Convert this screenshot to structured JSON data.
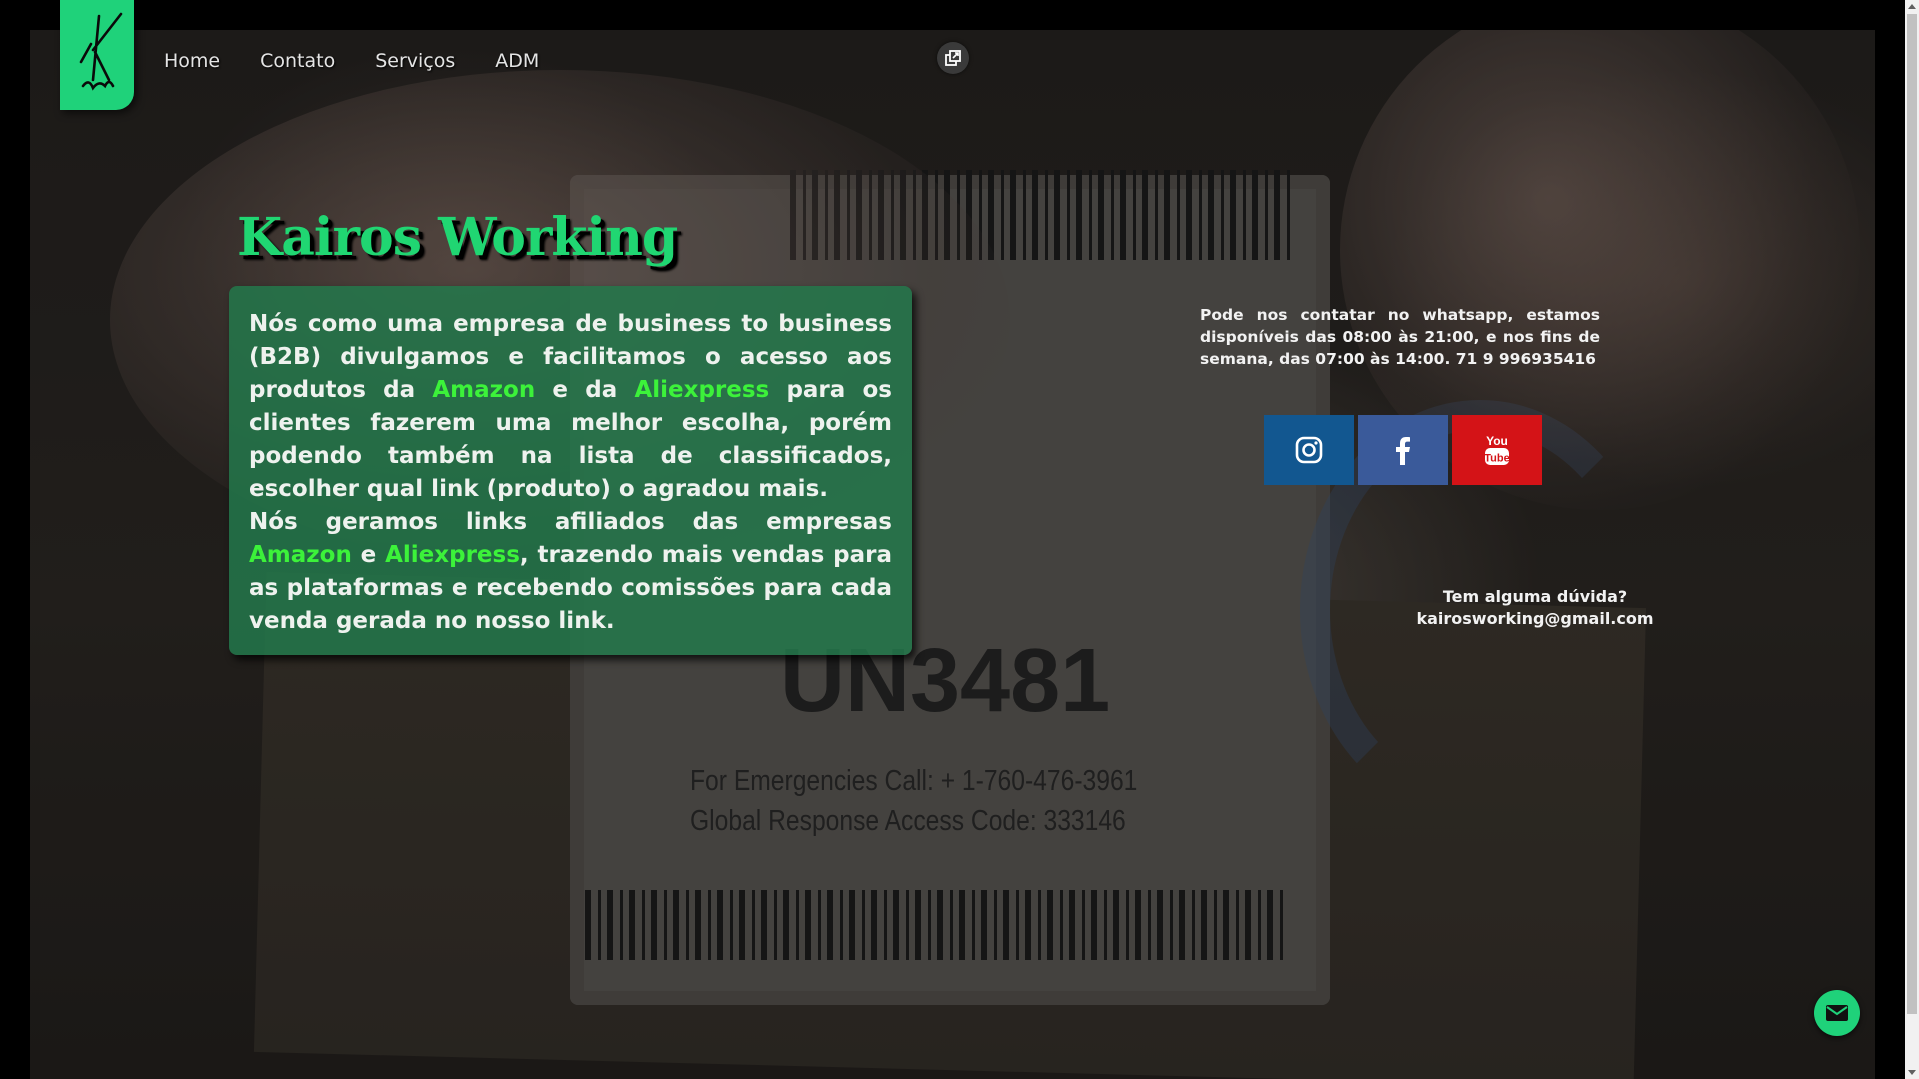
{
  "nav": {
    "items": [
      {
        "label": "Home"
      },
      {
        "label": "Contato"
      },
      {
        "label": "Serviços"
      },
      {
        "label": "ADM"
      }
    ]
  },
  "hero": {
    "title": "Kairos Working",
    "about": {
      "p1_part1": "Nós como uma empresa de business to business (B2B) divulgamos e facilitamos o acesso aos produtos da ",
      "amazon": "Amazon",
      "p1_part2": " e da ",
      "aliexpress": "Aliexpress",
      "p1_part3": " para os clientes fazerem uma melhor escolha, porém podendo também na lista de classificados, escolher qual link (produto) o agradou mais.",
      "p2_part1": "Nós geramos links afiliados das empresas ",
      "p2_part2": " e ",
      "p2_part3": ", trazendo mais vendas para as plataformas e recebendo comissões para cada venda gerada no nosso link."
    }
  },
  "contact": {
    "hours_text": "Pode nos contatar no whatsapp, estamos disponíveis das 08:00 às 21:00, e nos fins de semana, das 07:00 às 14:00. 71 9 996935416",
    "question": "Tem alguma dúvida?",
    "email": "kairosworking@gmail.com"
  },
  "background_text": {
    "emergency": "For Emergencies Call: + 1-760-476-3961",
    "access_code": "Global Response Access Code: 333146",
    "un_code": "UN3481"
  },
  "social": [
    {
      "name": "instagram",
      "color": "#125790"
    },
    {
      "name": "facebook",
      "color": "#3a5a9a"
    },
    {
      "name": "youtube",
      "color": "#d41317"
    }
  ],
  "colors": {
    "accent_green": "#1fd27a",
    "highlight_green": "#3cf23a",
    "panel_green": "#23784b"
  },
  "icons": {
    "logo": "kairos-logo-icon",
    "external": "open-external-icon",
    "mail": "mail-icon"
  }
}
